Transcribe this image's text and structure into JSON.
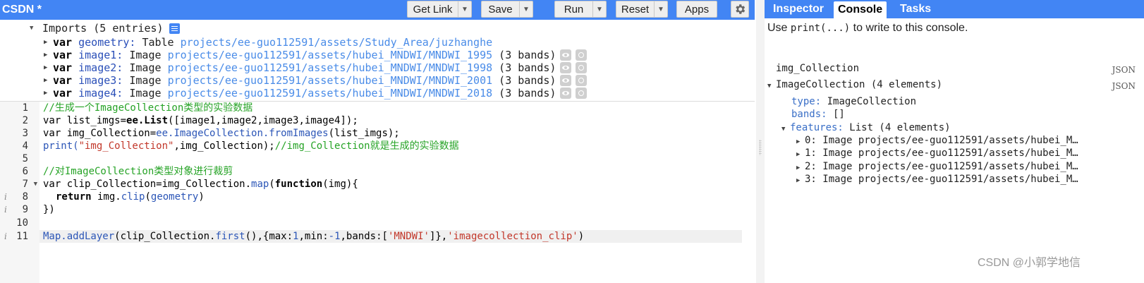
{
  "toolbar": {
    "title": "CSDN *",
    "get_link": "Get Link",
    "save": "Save",
    "run": "Run",
    "reset": "Reset",
    "apps": "Apps"
  },
  "imports": {
    "header": "Imports (5 entries)",
    "rows": [
      {
        "kw": "var",
        "name": "geometry:",
        "type": "Table",
        "path": "projects/ee-guo112591/assets/Study_Area/juzhanghe",
        "extra": ""
      },
      {
        "kw": "var",
        "name": "image1:",
        "type": "Image",
        "path": "projects/ee-guo112591/assets/hubei_MNDWI/MNDWI_1995",
        "extra": "(3 bands)"
      },
      {
        "kw": "var",
        "name": "image2:",
        "type": "Image",
        "path": "projects/ee-guo112591/assets/hubei_MNDWI/MNDWI_1998",
        "extra": "(3 bands)"
      },
      {
        "kw": "var",
        "name": "image3:",
        "type": "Image",
        "path": "projects/ee-guo112591/assets/hubei_MNDWI/MNDWI_2001",
        "extra": "(3 bands)"
      },
      {
        "kw": "var",
        "name": "image4:",
        "type": "Image",
        "path": "projects/ee-guo112591/assets/hubei_MNDWI/MNDWI_2018",
        "extra": "(3 bands)"
      }
    ]
  },
  "code": {
    "line_numbers": [
      "1",
      "2",
      "3",
      "4",
      "5",
      "6",
      "7",
      "8",
      "9",
      "10",
      "11"
    ],
    "l1": "//生成一个ImageCollection类型的实验数据",
    "l2a": "var list_imgs=",
    "l2b": "ee.List",
    "l2c": "([image1,image2,image3,image4]);",
    "l3a": "var img_Collection=",
    "l3b": "ee",
    "l3c": ".ImageCollection.fromImages",
    "l3d": "(list_imgs);",
    "l4a": "print(",
    "l4b": "\"img_Collection\"",
    "l4c": ",img_Collection);",
    "l4d": "//img_Collection就是生成的实验数据",
    "l6": "//对ImageCollection类型对象进行裁剪",
    "l7a": "var clip_Collection=img_Collection.",
    "l7b": "map",
    "l7c": "(",
    "l7d": "function",
    "l7e": "(img){",
    "l8a": "return",
    "l8b": " img.",
    "l8c": "clip",
    "l8d": "(",
    "l8e": "geometry",
    "l8f": ")",
    "l9": "})",
    "l11a": "Map.addLayer",
    "l11b": "(clip_Collection.",
    "l11c": "first",
    "l11d": "(),{max:",
    "l11e": "1",
    "l11f": ",min:",
    "l11g": "-1",
    "l11h": ",bands:[",
    "l11i": "'MNDWI'",
    "l11j": "]},",
    "l11k": "'imagecollection_clip'",
    "l11l": ")"
  },
  "tabs": [
    "Inspector",
    "Console",
    "Tasks"
  ],
  "console": {
    "hint_a": "Use ",
    "hint_code": "print(...)",
    "hint_b": " to write to this console.",
    "label": "img_Collection",
    "json": "JSON",
    "collection": "ImageCollection (4 elements)",
    "type_key": "type:",
    "type_val": " ImageCollection",
    "bands_key": "bands:",
    "bands_val": " []",
    "features_key": "features:",
    "features_val": " List (4 elements)",
    "items": [
      "0: Image projects/ee-guo112591/assets/hubei_M…",
      "1: Image projects/ee-guo112591/assets/hubei_M…",
      "2: Image projects/ee-guo112591/assets/hubei_M…",
      "3: Image projects/ee-guo112591/assets/hubei_M…"
    ]
  },
  "watermark": "CSDN @小郭学地信"
}
